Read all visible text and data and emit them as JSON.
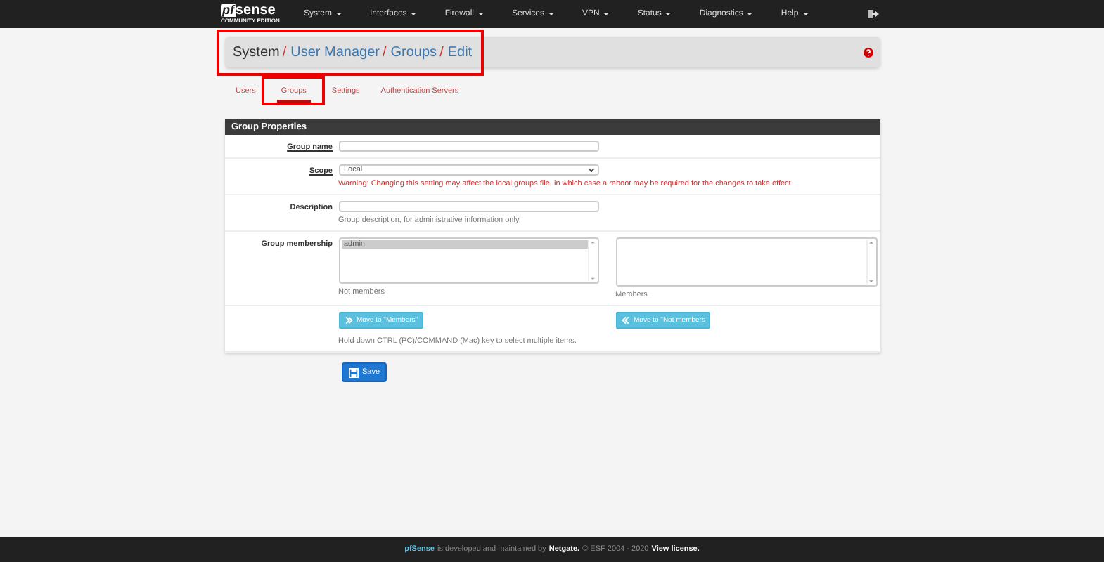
{
  "navbar": {
    "logo": {
      "brand_prefix": "pf",
      "brand": "sense",
      "edition": "COMMUNITY EDITION"
    },
    "menu": [
      {
        "label": "System"
      },
      {
        "label": "Interfaces"
      },
      {
        "label": "Firewall"
      },
      {
        "label": "Services"
      },
      {
        "label": "VPN"
      },
      {
        "label": "Status"
      },
      {
        "label": "Diagnostics"
      },
      {
        "label": "Help"
      }
    ]
  },
  "breadcrumb": [
    {
      "label": "System",
      "link": false,
      "separator": "/"
    },
    {
      "label": "User Manager",
      "link": true,
      "separator": "/"
    },
    {
      "label": "Groups",
      "link": true,
      "separator": "/"
    },
    {
      "label": "Edit",
      "link": true
    }
  ],
  "tabs": [
    {
      "label": "Users",
      "selected": false
    },
    {
      "label": "Groups",
      "selected": true
    },
    {
      "label": "Settings",
      "selected": false
    },
    {
      "label": "Authentication Servers",
      "selected": false
    }
  ],
  "panel": {
    "title": "Group Properties",
    "rows": [
      {
        "kind": "text",
        "label": "Group name",
        "required": true,
        "value": ""
      },
      {
        "kind": "select",
        "label": "Scope",
        "required": true,
        "value": "Local",
        "warning": "Warning: Changing this setting may affect the local groups file, in which case a reboot may be required for the changes to take effect."
      },
      {
        "kind": "text",
        "label": "Description",
        "required": false,
        "value": "",
        "help": "Group description, for administrative information only"
      },
      {
        "kind": "membership",
        "label": "Group membership",
        "not_members": [
          {
            "name": "admin",
            "selected": true
          }
        ],
        "not_members_caption": "Not members",
        "members": [],
        "members_caption": "Members"
      },
      {
        "kind": "move",
        "left_button": "Move to \"Members\"",
        "right_button": "Move to \"Not members",
        "help": "Hold down CTRL (PC)/COMMAND (Mac) key to select multiple items."
      }
    ]
  },
  "save_button": "Save",
  "footer": {
    "brand": "pfSense",
    "text": "is developed and maintained by",
    "company": "Netgate.",
    "copyright": "© ESF 2004 - 2020",
    "license_link": "View license."
  }
}
